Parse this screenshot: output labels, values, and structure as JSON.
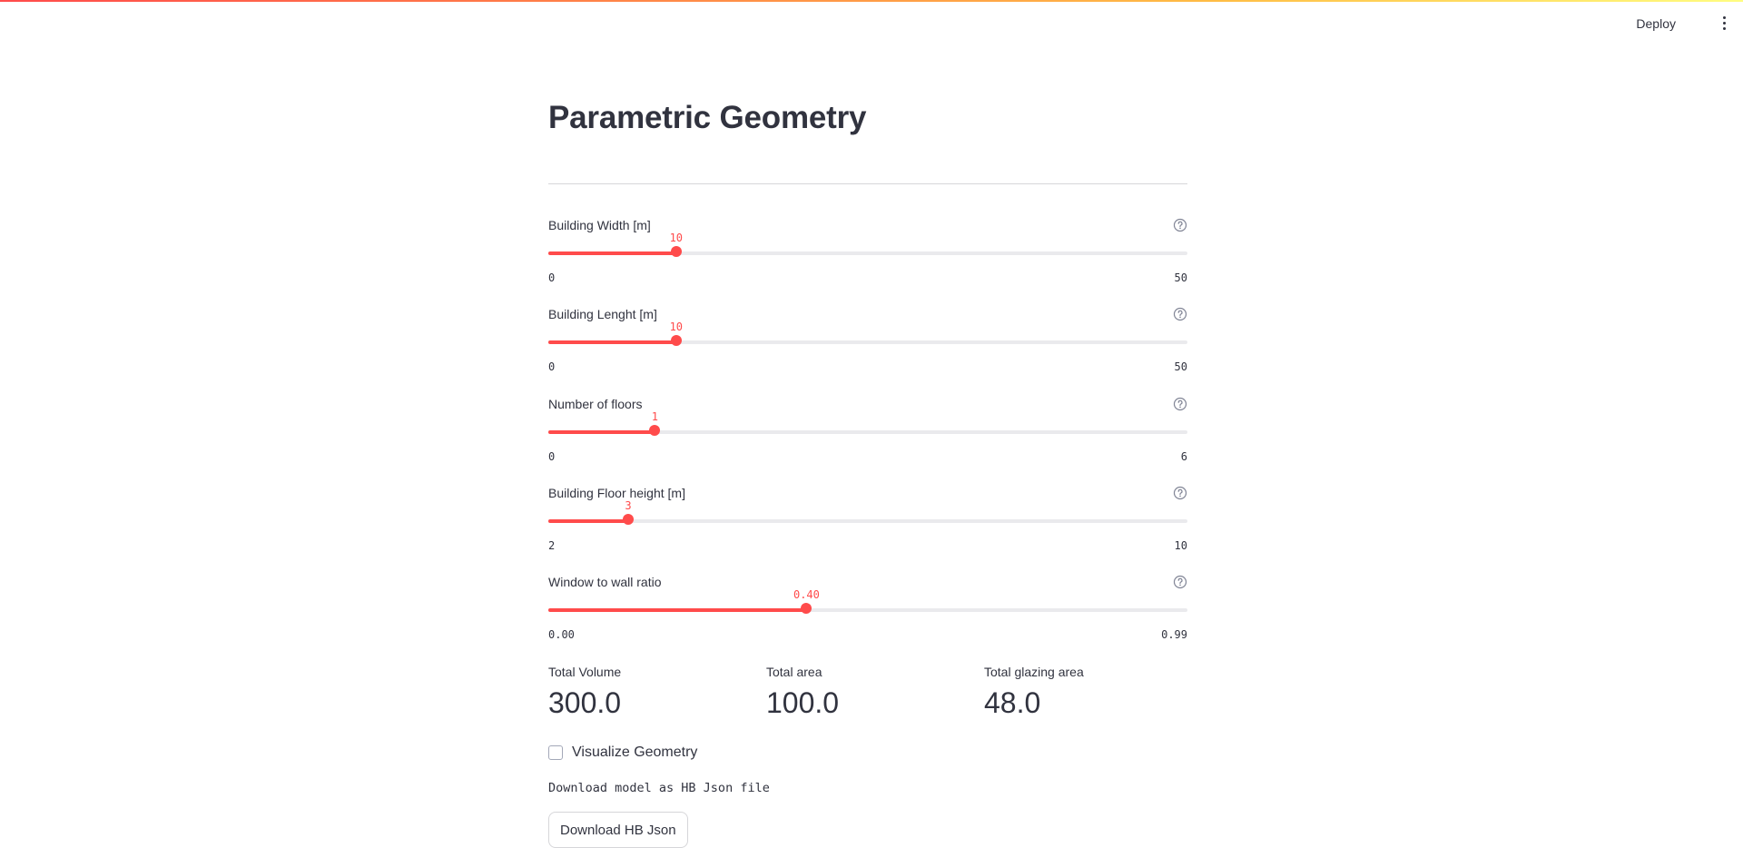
{
  "header": {
    "deploy_label": "Deploy",
    "menu_icon": "kebab-menu-icon"
  },
  "page": {
    "title": "Parametric Geometry"
  },
  "sliders": [
    {
      "label": "Building Width [m]",
      "value": 10,
      "value_text": "10",
      "min": 0,
      "max": 50,
      "min_text": "0",
      "max_text": "50",
      "help_icon": "help-circle-icon"
    },
    {
      "label": "Building Lenght [m]",
      "value": 10,
      "value_text": "10",
      "min": 0,
      "max": 50,
      "min_text": "0",
      "max_text": "50",
      "help_icon": "help-circle-icon"
    },
    {
      "label": "Number of floors",
      "value": 1,
      "value_text": "1",
      "min": 0,
      "max": 6,
      "min_text": "0",
      "max_text": "6",
      "help_icon": "help-circle-icon"
    },
    {
      "label": "Building Floor height [m]",
      "value": 3,
      "value_text": "3",
      "min": 2,
      "max": 10,
      "min_text": "2",
      "max_text": "10",
      "help_icon": "help-circle-icon"
    },
    {
      "label": "Window to wall ratio",
      "value": 0.4,
      "value_text": "0.40",
      "min": 0,
      "max": 0.99,
      "min_text": "0.00",
      "max_text": "0.99",
      "help_icon": "help-circle-icon"
    }
  ],
  "metrics": [
    {
      "label": "Total Volume",
      "value": "300.0"
    },
    {
      "label": "Total area",
      "value": "100.0"
    },
    {
      "label": "Total glazing area",
      "value": "48.0"
    }
  ],
  "visualize": {
    "label": "Visualize Geometry",
    "checked": false
  },
  "download": {
    "text": "Download model as HB Json file",
    "button_label": "Download HB Json"
  },
  "colors": {
    "accent": "#ff4b4b",
    "text": "#31333f",
    "track": "#eaeaed"
  }
}
